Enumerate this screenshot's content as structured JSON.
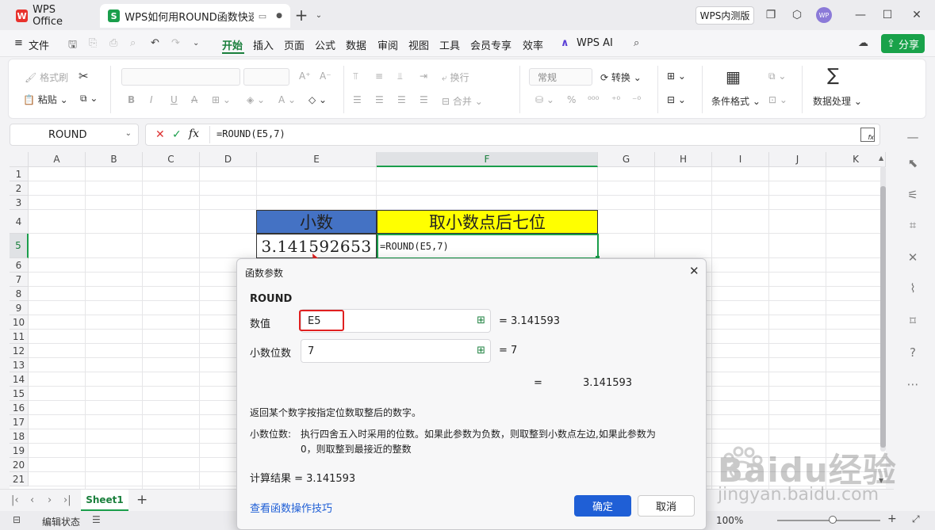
{
  "tabs": {
    "wps": "WPS Office",
    "doc": "WPS如何用ROUND函数快速"
  },
  "titlebar": {
    "beta_badge": "WPS内测版",
    "avatar": "WP"
  },
  "menu": {
    "file": "文件",
    "items": [
      "开始",
      "插入",
      "页面",
      "公式",
      "数据",
      "审阅",
      "视图",
      "工具",
      "会员专享",
      "效率"
    ],
    "wps_ai": "WPS AI",
    "share": "分享"
  },
  "ribbon": {
    "format_painter": "格式刷",
    "paste": "粘贴",
    "wrap": "换行",
    "number_format": "常规",
    "convert": "转换",
    "merge": "合并",
    "conditional_format": "条件格式",
    "data_processing": "数据处理"
  },
  "formula_bar": {
    "name_box": "ROUND",
    "fx": "fx",
    "formula": "=ROUND(E5,7)"
  },
  "sheet": {
    "columns": [
      "A",
      "B",
      "C",
      "D",
      "E",
      "F",
      "G",
      "H",
      "I",
      "J",
      "K"
    ],
    "rows": [
      "1",
      "2",
      "3",
      "4",
      "5",
      "6",
      "7",
      "8",
      "9",
      "10",
      "11",
      "12",
      "13",
      "14",
      "15",
      "16",
      "17",
      "18",
      "19",
      "20",
      "21"
    ],
    "e4": "小数",
    "f4": "取小数点后七位",
    "e5": "3.141592653",
    "f5": "=ROUND(E5,7)"
  },
  "sheet_tab": "Sheet1",
  "status": {
    "edit": "编辑状态",
    "zoom": "100%"
  },
  "dialog": {
    "title": "函数参数",
    "function_name": "ROUND",
    "arg1_label": "数值",
    "arg1_value": "E5",
    "arg1_result": "=  3.141593",
    "arg2_label": "小数位数",
    "arg2_value": "7",
    "arg2_result": "=  7",
    "eq": "=",
    "total_value": "3.141593",
    "description": "返回某个数字按指定位数取整后的数字。",
    "param_label": "小数位数:",
    "param_desc_1": "执行四舍五入时采用的位数。如果此参数为负数，则取整到小数点左边,如果此参数为",
    "param_desc_2": "0，则取整到最接近的整数",
    "calc_result": "计算结果  =  3.141593",
    "help_link": "查看函数操作技巧",
    "ok": "确定",
    "cancel": "取消"
  },
  "watermark": {
    "brand": "Baidu经验",
    "url": "jingyan.baidu.com"
  },
  "colors": {
    "accent_green": "#1a7f3c",
    "header_blue": "#4472c4",
    "header_yellow": "#ffff00",
    "ok_blue": "#1f5fd6",
    "highlight_red": "#e02020"
  }
}
